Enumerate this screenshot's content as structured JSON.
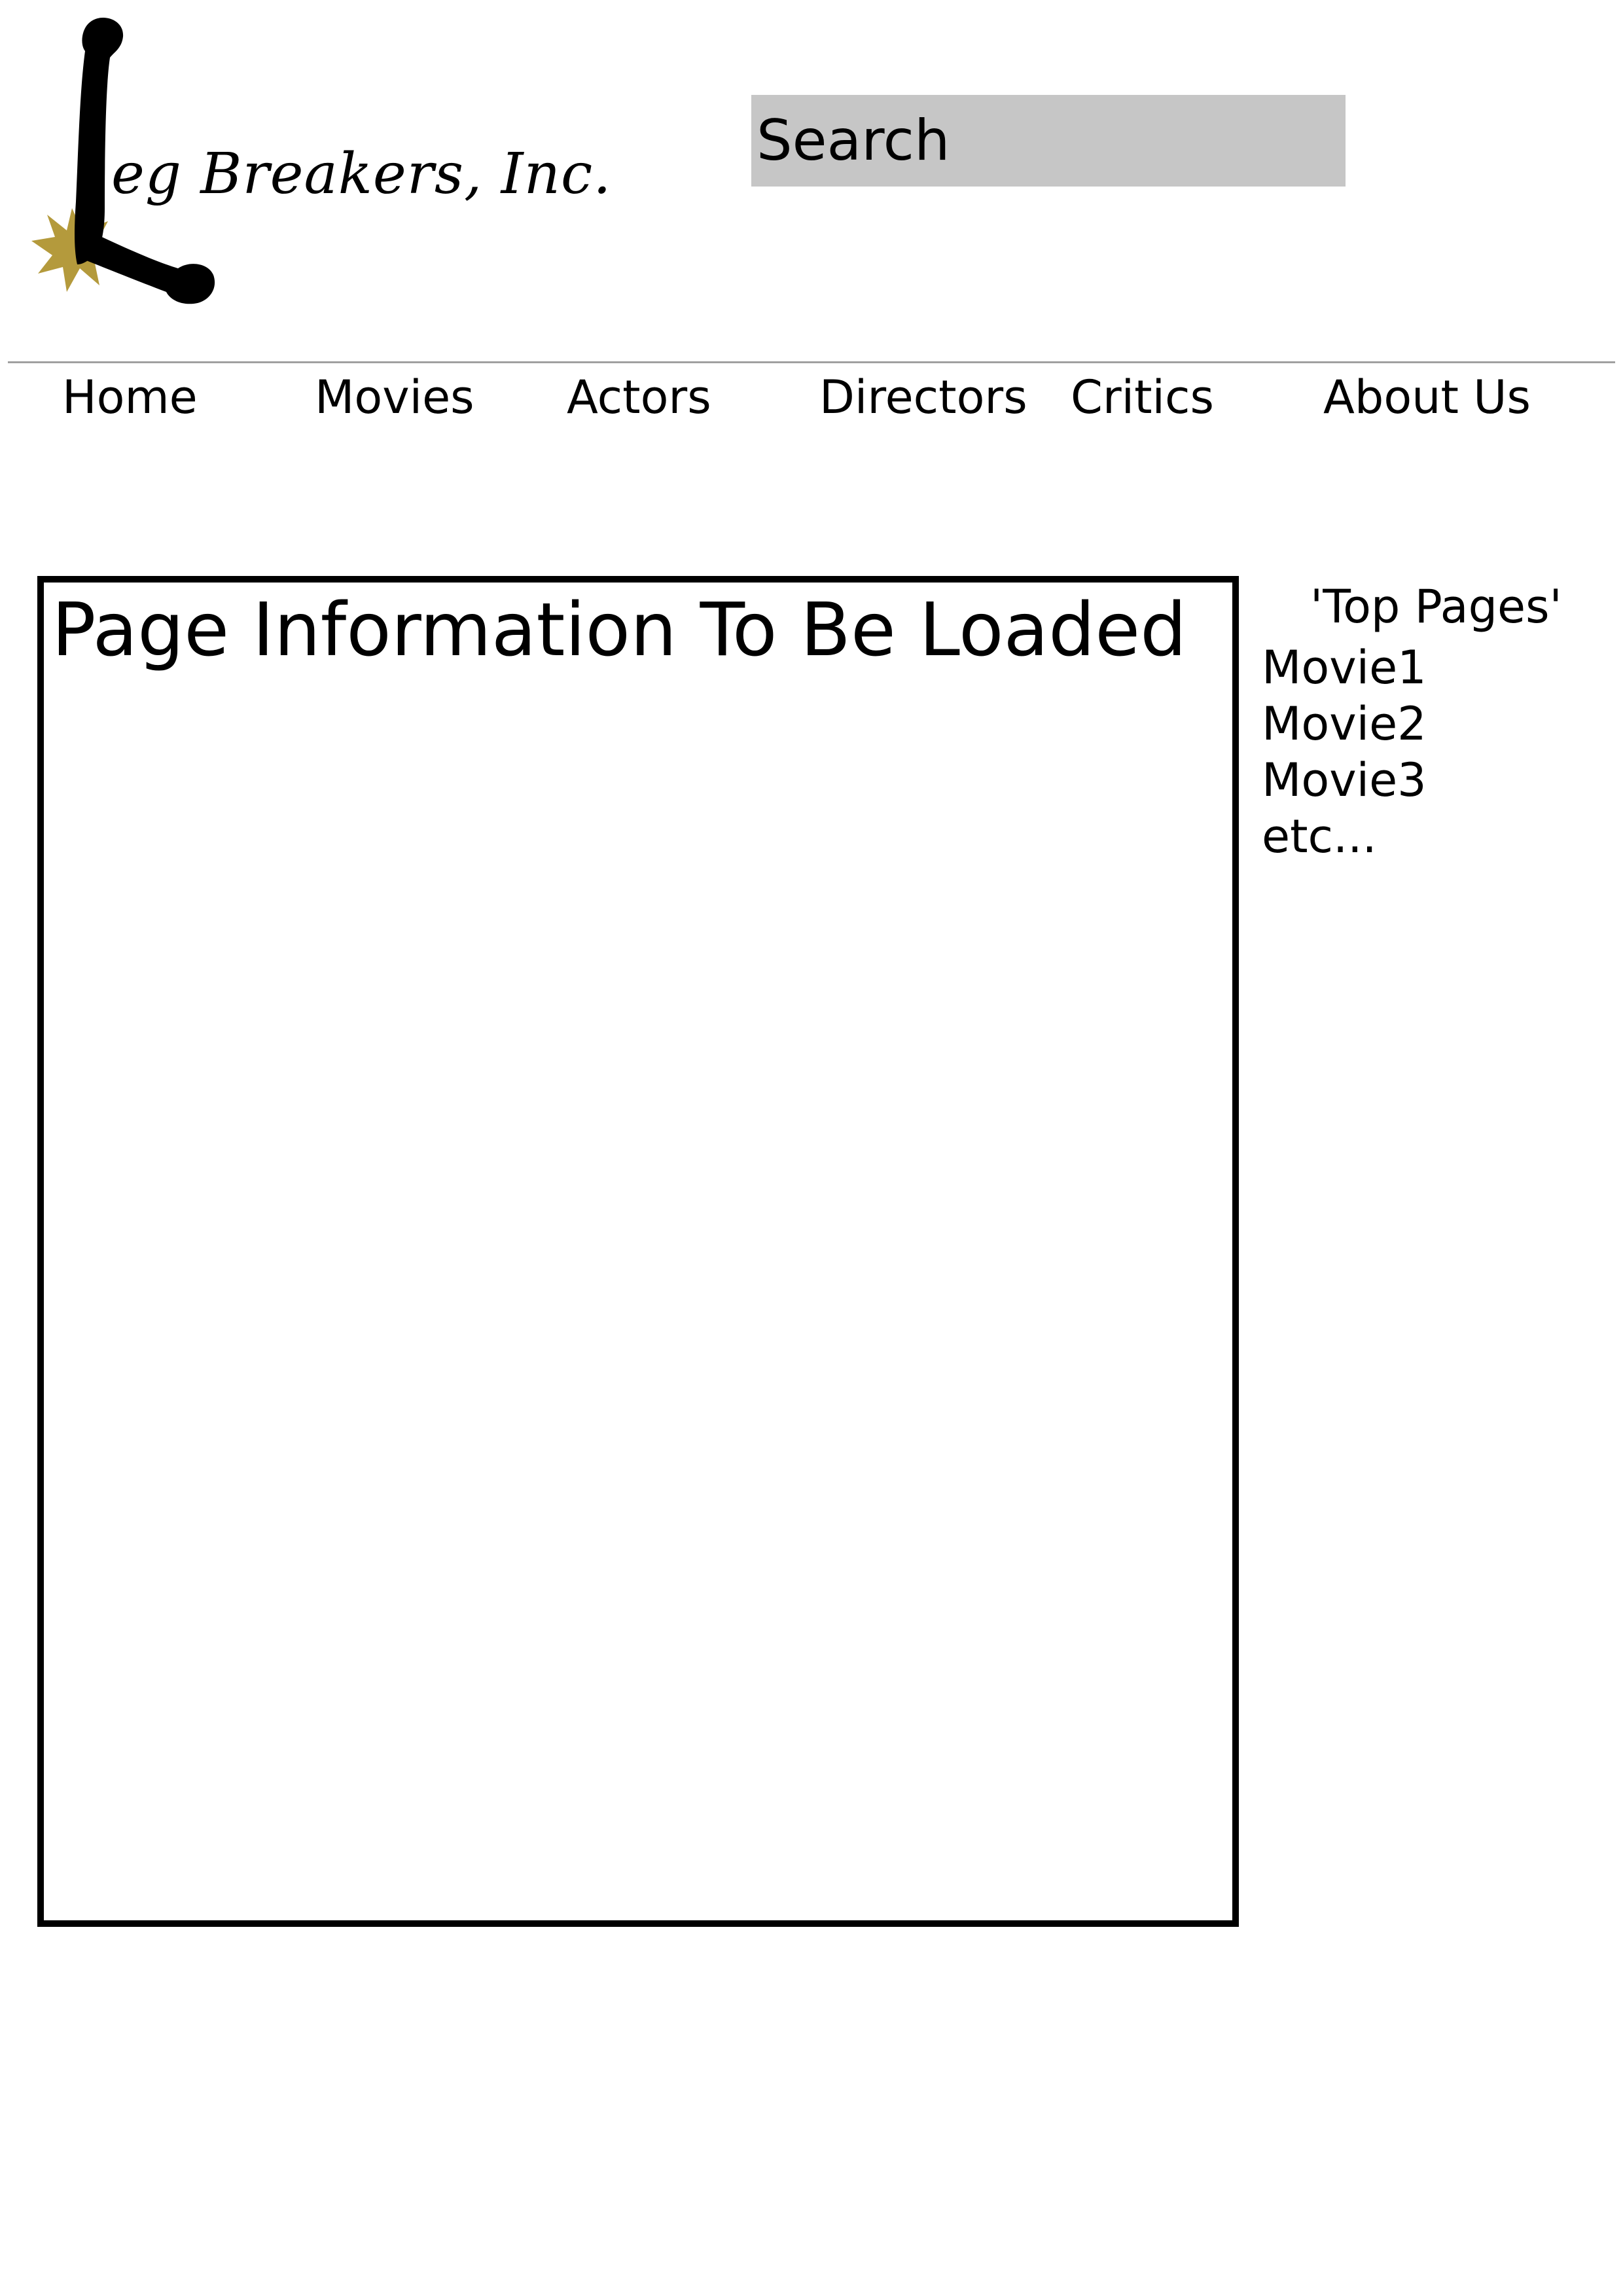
{
  "header": {
    "logo_text": "eg Breakers, Inc.",
    "logo_accent_color": "#b49a3c",
    "logo_icon": "bone-L-logo-icon"
  },
  "search": {
    "placeholder": "Search",
    "value": ""
  },
  "nav": {
    "items": [
      {
        "label": "Home"
      },
      {
        "label": "Movies"
      },
      {
        "label": "Actors"
      },
      {
        "label": "Directors"
      },
      {
        "label": "Critics"
      },
      {
        "label": "About Us"
      }
    ]
  },
  "main": {
    "title": "Page Information To Be Loaded"
  },
  "sidebar": {
    "title": "'Top Pages'",
    "items": [
      {
        "label": "Movie1"
      },
      {
        "label": "Movie2"
      },
      {
        "label": "Movie3"
      },
      {
        "label": "etc..."
      }
    ]
  },
  "colors": {
    "search_bg": "#c6c6c6",
    "nav_rule": "#a0a0a0",
    "border": "#000000"
  }
}
